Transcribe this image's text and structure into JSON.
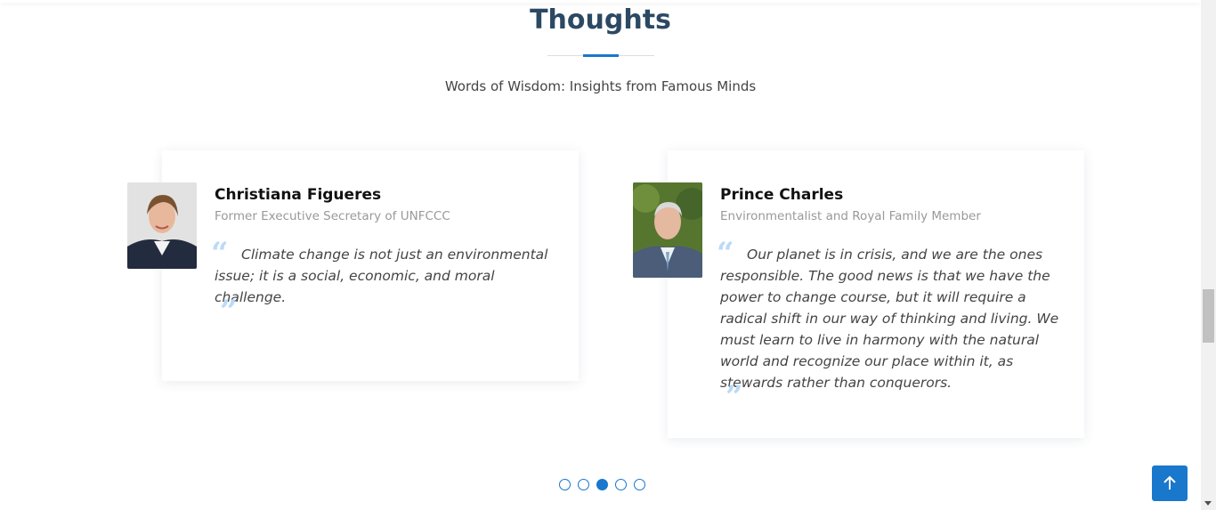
{
  "section": {
    "title": "Thoughts",
    "subtitle": "Words of Wisdom: Insights from Famous Minds"
  },
  "testimonials": [
    {
      "name": "Christiana Figueres",
      "role": "Former Executive Secretary of UNFCCC",
      "quote": "Climate change is not just an environmental issue; it is a social, economic, and moral challenge."
    },
    {
      "name": "Prince Charles",
      "role": "Environmentalist and Royal Family Member",
      "quote": "Our planet is in crisis, and we are the ones responsible. The good news is that we have the power to change course, but it will require a radical shift in our way of thinking and living. We must learn to live in harmony with the natural world and recognize our place within it, as stewards rather than conquerors."
    }
  ],
  "pagination": {
    "total": 5,
    "active": 3
  },
  "icons": {
    "quote_open": "quote-left-icon",
    "quote_close": "quote-right-icon",
    "back_to_top": "arrow-up-icon"
  },
  "colors": {
    "accent": "#1977cc",
    "heading": "#2c4964",
    "quote_mark": "#badaf7"
  }
}
